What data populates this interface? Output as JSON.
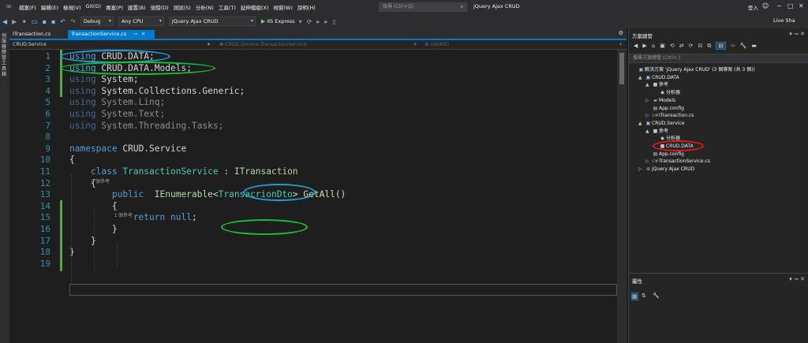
{
  "menu": {
    "items": [
      "檔案(F)",
      "編輯(E)",
      "檢視(V)",
      "Git(G)",
      "專案(P)",
      "建置(B)",
      "偵錯(D)",
      "測試(S)",
      "分析(N)",
      "工具(T)",
      "延伸模組(X)",
      "視窗(W)",
      "說明(H)"
    ],
    "search_placeholder": "搜尋 (Ctrl+Q)",
    "window_title": "jQuery Ajax CRUD",
    "login": "登入",
    "live_share": "Live Sha"
  },
  "toolbar": {
    "config": "Debug",
    "platform": "Any CPU",
    "startup_project": "jQuery Ajax CRUD",
    "run_target": "IIS Express"
  },
  "left_strip": {
    "label": "伺服器總管 工具箱"
  },
  "tabs": [
    {
      "label": "ITransaction.cs",
      "active": false
    },
    {
      "label": "TransactionService.cs",
      "active": true
    }
  ],
  "navbar": {
    "project": "CRUD.Service",
    "type": "CRUD.Service.TransactionService",
    "member": "GetAll()"
  },
  "editor": {
    "lines": [
      {
        "n": "1",
        "tokens": [
          {
            "t": "using",
            "c": "kw"
          },
          {
            "t": " CRUD.DATA;",
            "c": "ns"
          }
        ]
      },
      {
        "n": "2",
        "tokens": [
          {
            "t": "using",
            "c": "kw"
          },
          {
            "t": " CRUD.DATA.Models;",
            "c": "ns"
          }
        ]
      },
      {
        "n": "3",
        "tokens": [
          {
            "t": "using",
            "c": "kw dim"
          },
          {
            "t": " System;",
            "c": "ns"
          }
        ]
      },
      {
        "n": "4",
        "tokens": [
          {
            "t": "using",
            "c": "kw dim"
          },
          {
            "t": " System.Collections.Generic;",
            "c": "ns"
          }
        ]
      },
      {
        "n": "5",
        "tokens": [
          {
            "t": "using",
            "c": "kw dim"
          },
          {
            "t": " System.Linq;",
            "c": "ns dim"
          }
        ]
      },
      {
        "n": "6",
        "tokens": [
          {
            "t": "using",
            "c": "kw dim"
          },
          {
            "t": " System.Text;",
            "c": "ns dim"
          }
        ]
      },
      {
        "n": "7",
        "tokens": [
          {
            "t": "using",
            "c": "kw dim"
          },
          {
            "t": " System.Threading.Tasks;",
            "c": "ns dim"
          }
        ]
      },
      {
        "n": "8",
        "tokens": []
      },
      {
        "n": "9",
        "tokens": [
          {
            "t": "namespace",
            "c": "kw"
          },
          {
            "t": " CRUD.Service",
            "c": "ns"
          }
        ]
      },
      {
        "n": "10",
        "tokens": [
          {
            "t": "{",
            "c": "punc"
          }
        ]
      },
      {
        "n": "11",
        "tokens": [
          {
            "t": "    class",
            "c": "kw"
          },
          {
            "t": " TransactionService",
            "c": "cls"
          },
          {
            "t": " : ",
            "c": "punc"
          },
          {
            "t": "ITransaction",
            "c": "iface"
          }
        ]
      },
      {
        "n": "12",
        "tokens": [
          {
            "t": "    {",
            "c": "punc"
          }
        ]
      },
      {
        "n": "13",
        "tokens": [
          {
            "t": "        public",
            "c": "kw"
          },
          {
            "t": "  IEnumerable",
            "c": "iface"
          },
          {
            "t": "<",
            "c": "punc"
          },
          {
            "t": "TransacrionDto",
            "c": "cls"
          },
          {
            "t": "> ",
            "c": "punc"
          },
          {
            "t": "GetAll",
            "c": "mth"
          },
          {
            "t": "()",
            "c": "punc"
          }
        ]
      },
      {
        "n": "14",
        "tokens": [
          {
            "t": "        {",
            "c": "punc"
          }
        ]
      },
      {
        "n": "15",
        "tokens": [
          {
            "t": "            return",
            "c": "kw"
          },
          {
            "t": " null",
            "c": "kw"
          },
          {
            "t": ";",
            "c": "punc"
          }
        ]
      },
      {
        "n": "16",
        "tokens": [
          {
            "t": "        }",
            "c": "punc"
          }
        ]
      },
      {
        "n": "17",
        "tokens": [
          {
            "t": "    }",
            "c": "punc"
          }
        ]
      },
      {
        "n": "18",
        "tokens": [
          {
            "t": "}",
            "c": "punc"
          }
        ]
      },
      {
        "n": "19",
        "tokens": []
      }
    ],
    "codelens_class": "0 個參考",
    "codelens_method": "1 個參考"
  },
  "solution": {
    "title": "方案總管",
    "search_placeholder": "搜尋方案總管 (Ctrl+;)",
    "tree": [
      {
        "label": "解決方案 'jQuery Ajax CRUD' (3 個專案 (共 3 個))",
        "depth": 0,
        "twisty": "",
        "icon": "sln"
      },
      {
        "label": "CRUD.DATA",
        "depth": 1,
        "twisty": "▲",
        "icon": "proj"
      },
      {
        "label": "參考",
        "depth": 2,
        "twisty": "▲",
        "icon": "ref"
      },
      {
        "label": "分析器",
        "depth": 3,
        "twisty": "",
        "icon": "ana"
      },
      {
        "label": "Models",
        "depth": 2,
        "twisty": "▷",
        "icon": "folder"
      },
      {
        "label": "App.config",
        "depth": 2,
        "twisty": "",
        "icon": "cfg"
      },
      {
        "label": "ITransaction.cs",
        "depth": 2,
        "twisty": "▷",
        "icon": "cs"
      },
      {
        "label": "CRUD.Service",
        "depth": 1,
        "twisty": "▲",
        "icon": "proj"
      },
      {
        "label": "參考",
        "depth": 2,
        "twisty": "▲",
        "icon": "ref"
      },
      {
        "label": "分析器",
        "depth": 3,
        "twisty": "",
        "icon": "ana"
      },
      {
        "label": "CRUD.DATA",
        "depth": 3,
        "twisty": "",
        "icon": "ref"
      },
      {
        "label": "App.config",
        "depth": 2,
        "twisty": "",
        "icon": "cfg"
      },
      {
        "label": "TransactionService.cs",
        "depth": 2,
        "twisty": "▷",
        "icon": "cs"
      },
      {
        "label": "jQuery Ajax CRUD",
        "depth": 1,
        "twisty": "▷",
        "icon": "web"
      }
    ]
  },
  "properties": {
    "title": "屬性"
  },
  "annotation_colors": {
    "blue": "#1e9fd8",
    "green": "#19c034",
    "red": "#e01818"
  }
}
